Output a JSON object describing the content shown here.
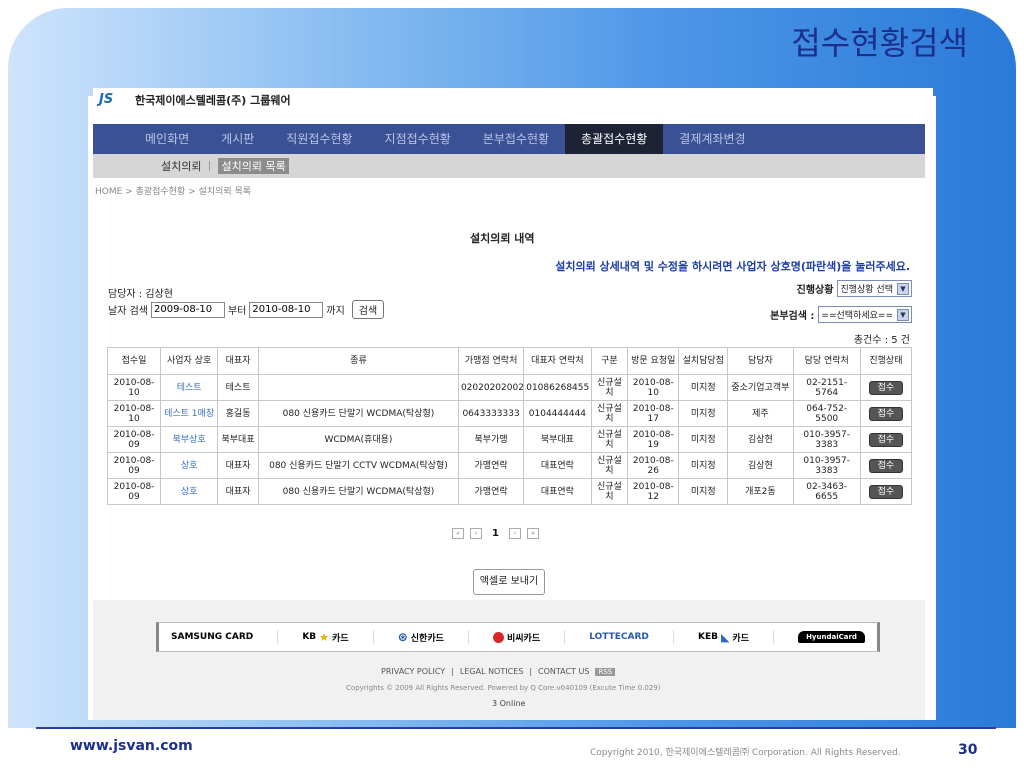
{
  "slide": {
    "title": "접수현황검색",
    "url": "www.jsvan.com",
    "copyright": "Copyright 2010, 한국제이에스텔레콤㈜ Corporation. All Rights Reserved.",
    "page_number": "30"
  },
  "header": {
    "logo_text": "JS",
    "company": "한국제이에스텔레콤(주) 그룹웨어"
  },
  "nav": {
    "items": [
      "메인화면",
      "게시판",
      "직원접수현황",
      "지점접수현황",
      "본부접수현황",
      "총괄접수현황",
      "결제계좌변경"
    ],
    "active_index": 5
  },
  "subnav": {
    "item": "설치의뢰",
    "active": "설치의뢰 목록"
  },
  "breadcrumb": "HOME > 총괄접수현황 > 설치의뢰 목록",
  "section_title": "설치의뢰 내역",
  "notice": "설치의뢰 상세내역 및 수정을 하시려면 사업자 상호명(파란색)을 눌러주세요.",
  "filters": {
    "manager_label": "담당자 : 김상현",
    "date_label": "날자 검색",
    "date_from": "2009-08-10",
    "from_suffix": "부터",
    "date_to": "2010-08-10",
    "to_suffix": "까지",
    "search_button": "검색",
    "progress_label": "진행상황",
    "progress_select": "진행상황 선택",
    "region_label": "본부검색 :",
    "region_select": "==선택하세요=="
  },
  "total": "총건수 : 5 건",
  "table": {
    "headers": [
      "접수일",
      "사업자 상호",
      "대표자",
      "종류",
      "가맹점 연락처",
      "대표자 연락처",
      "구분",
      "방문 요청일",
      "설치담당점",
      "담당자",
      "담당 연락처",
      "진행상태"
    ],
    "rows": [
      [
        "2010-08-10",
        "테스트",
        "테스트",
        "",
        "02020202002",
        "01086268455",
        "신규설치",
        "2010-08-10",
        "미지정",
        "중소기업고객부",
        "02-2151-5764",
        "접수"
      ],
      [
        "2010-08-10",
        "테스트 1매장",
        "홍길동",
        "080 신용카드 단말기 WCDMA(탁상형)",
        "0643333333",
        "0104444444",
        "신규설치",
        "2010-08-17",
        "미지정",
        "제주",
        "064-752-5500",
        "접수"
      ],
      [
        "2010-08-09",
        "북부상호",
        "북부대표",
        "WCDMA(휴대용)",
        "북부가맹",
        "북부대표",
        "신규설치",
        "2010-08-19",
        "미지정",
        "김상현",
        "010-3957-3383",
        "접수"
      ],
      [
        "2010-08-09",
        "상호",
        "대표자",
        "080 신용카드 단말기 CCTV WCDMA(탁상형)",
        "가맹연락",
        "대표연락",
        "신규설치",
        "2010-08-26",
        "미지정",
        "김상현",
        "010-3957-3383",
        "접수"
      ],
      [
        "2010-08-09",
        "상호",
        "대표자",
        "080 신용카드 단말기 WCDMA(탁상형)",
        "가맹연락",
        "대표연락",
        "신규설치",
        "2010-08-12",
        "미지정",
        "개포2동",
        "02-3463-6655",
        "접수"
      ]
    ]
  },
  "pager": {
    "first": "«",
    "prev": "‹",
    "current": "1",
    "next": "›",
    "last": "»"
  },
  "excel_button": "액셀로 보내기",
  "cards": [
    "SAMSUNG CARD",
    "KB",
    "카드",
    "신한카드",
    "비씨카드",
    "LOTTECARD",
    "KEB",
    "카드",
    "HyundaiCard"
  ],
  "footer": {
    "privacy": "PRIVACY POLICY",
    "legal": "LEGAL NOTICES",
    "contact": "CONTACT US",
    "rss": "RSS",
    "rights": "Copyrights © 2009 All Rights Reserved. Powered by Q Core.v040109 (Excute Time 0.029)",
    "online": "3 Online"
  }
}
